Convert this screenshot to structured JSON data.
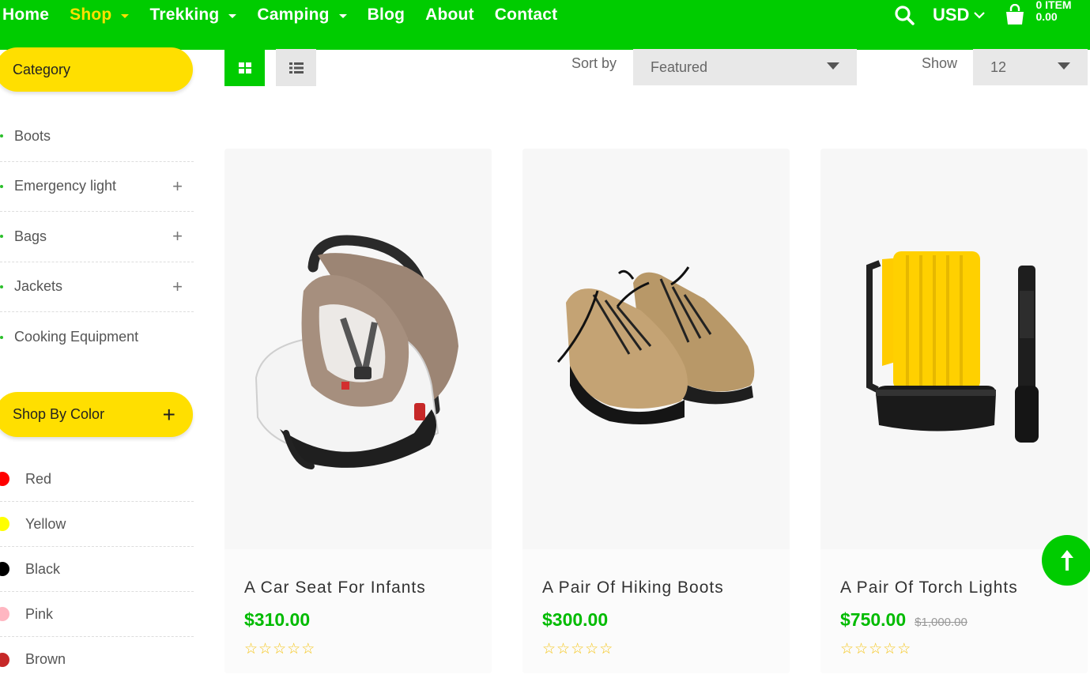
{
  "nav": {
    "items": [
      {
        "label": "Home",
        "dropdown": false,
        "active": false
      },
      {
        "label": "Shop",
        "dropdown": true,
        "active": true
      },
      {
        "label": "Trekking",
        "dropdown": true,
        "active": false
      },
      {
        "label": "Camping",
        "dropdown": true,
        "active": false
      },
      {
        "label": "Blog",
        "dropdown": false,
        "active": false
      },
      {
        "label": "About",
        "dropdown": false,
        "active": false
      },
      {
        "label": "Contact",
        "dropdown": false,
        "active": false
      }
    ],
    "currency": "USD",
    "cart_items": "0 ITEM",
    "cart_total": "0.00"
  },
  "sidebar": {
    "category_title": "Category",
    "categories": [
      {
        "label": "Boots",
        "expandable": false
      },
      {
        "label": "Emergency light",
        "expandable": true
      },
      {
        "label": "Bags",
        "expandable": true
      },
      {
        "label": "Jackets",
        "expandable": true
      },
      {
        "label": "Cooking Equipment",
        "expandable": false
      }
    ],
    "color_title": "Shop By Color",
    "colors": [
      {
        "label": "Red",
        "swatch": "#ff0000"
      },
      {
        "label": "Yellow",
        "swatch": "#ffff00"
      },
      {
        "label": "Black",
        "swatch": "#000000"
      },
      {
        "label": "Pink",
        "swatch": "#ffb6c1"
      },
      {
        "label": "Brown",
        "swatch": "#c62828"
      }
    ]
  },
  "toolbar": {
    "sort_label": "Sort by",
    "sort_value": "Featured",
    "show_label": "Show",
    "show_value": "12"
  },
  "products": [
    {
      "title": "A Car Seat For Infants",
      "price": "$310.00",
      "old_price": "",
      "image": "car-seat-image"
    },
    {
      "title": "A Pair Of Hiking Boots",
      "price": "$300.00",
      "old_price": "",
      "image": "hiking-boots-image"
    },
    {
      "title": "A Pair Of Torch Lights",
      "price": "$750.00",
      "old_price": "$1,000.00",
      "image": "torch-lights-image"
    }
  ],
  "colors": {
    "brand_green": "#00cc00",
    "accent_yellow": "#ffdf00",
    "price_green": "#00bb00",
    "star_yellow": "#f5c518"
  }
}
